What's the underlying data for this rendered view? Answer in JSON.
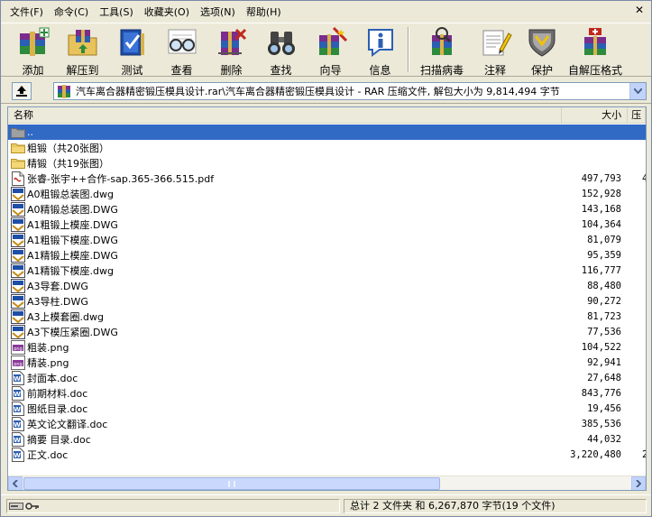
{
  "menu": [
    "文件(F)",
    "命令(C)",
    "工具(S)",
    "收藏夹(O)",
    "选项(N)",
    "帮助(H)"
  ],
  "toolbar": [
    {
      "label": "添加",
      "icon": "add-books-icon"
    },
    {
      "label": "解压到",
      "icon": "extract-folder-icon"
    },
    {
      "label": "测试",
      "icon": "test-book-icon"
    },
    {
      "label": "查看",
      "icon": "view-glasses-icon"
    },
    {
      "label": "删除",
      "icon": "delete-icon"
    },
    {
      "label": "查找",
      "icon": "find-binoculars-icon"
    },
    {
      "label": "向导",
      "icon": "wizard-icon"
    },
    {
      "label": "信息",
      "icon": "info-icon"
    },
    {
      "label": "扫描病毒",
      "icon": "virus-scan-icon"
    },
    {
      "label": "注释",
      "icon": "comment-icon"
    },
    {
      "label": "保护",
      "icon": "protect-shield-icon"
    },
    {
      "label": "自解压格式",
      "icon": "sfx-icon"
    }
  ],
  "address": {
    "text": "汽车离合器精密锻压模具设计.rar\\汽车离合器精密锻压模具设计 - RAR 压缩文件, 解包大小为 9,814,494 字节"
  },
  "columns": {
    "name": "名称",
    "size": "大小",
    "packed": "压"
  },
  "files": [
    {
      "name": "..",
      "size": "",
      "packed": "",
      "type": "parent",
      "selected": true
    },
    {
      "name": "粗锻（共20张图）",
      "size": "",
      "packed": "",
      "type": "folder"
    },
    {
      "name": "精锻（共19张图）",
      "size": "",
      "packed": "",
      "type": "folder"
    },
    {
      "name": "张睿-张宇++合作-sap.365-366.515.pdf",
      "size": "497,793",
      "packed": "4",
      "type": "pdf"
    },
    {
      "name": "A0粗锻总装图.dwg",
      "size": "152,928",
      "packed": "",
      "type": "dwg"
    },
    {
      "name": "A0精锻总装图.DWG",
      "size": "143,168",
      "packed": "",
      "type": "dwg"
    },
    {
      "name": "A1粗锻上模座.DWG",
      "size": "104,364",
      "packed": "",
      "type": "dwg"
    },
    {
      "name": "A1粗锻下模座.DWG",
      "size": "81,079",
      "packed": "",
      "type": "dwg"
    },
    {
      "name": "A1精锻上模座.DWG",
      "size": "95,359",
      "packed": "",
      "type": "dwg"
    },
    {
      "name": "A1精锻下模座.dwg",
      "size": "116,777",
      "packed": "",
      "type": "dwg"
    },
    {
      "name": "A3导套.DWG",
      "size": "88,480",
      "packed": "",
      "type": "dwg"
    },
    {
      "name": "A3导柱.DWG",
      "size": "90,272",
      "packed": "",
      "type": "dwg"
    },
    {
      "name": "A3上模套圈.dwg",
      "size": "81,723",
      "packed": "",
      "type": "dwg"
    },
    {
      "name": "A3下模压紧圈.DWG",
      "size": "77,536",
      "packed": "",
      "type": "dwg"
    },
    {
      "name": "粗装.png",
      "size": "104,522",
      "packed": "",
      "type": "png"
    },
    {
      "name": "精装.png",
      "size": "92,941",
      "packed": "",
      "type": "png"
    },
    {
      "name": "封面本.doc",
      "size": "27,648",
      "packed": "",
      "type": "doc"
    },
    {
      "name": "前期材料.doc",
      "size": "843,776",
      "packed": "",
      "type": "doc"
    },
    {
      "name": "图纸目录.doc",
      "size": "19,456",
      "packed": "",
      "type": "doc"
    },
    {
      "name": "英文论文翻译.doc",
      "size": "385,536",
      "packed": "",
      "type": "doc"
    },
    {
      "name": "摘要 目录.doc",
      "size": "44,032",
      "packed": "",
      "type": "doc"
    },
    {
      "name": "正文.doc",
      "size": "3,220,480",
      "packed": "2",
      "type": "doc"
    }
  ],
  "status": {
    "right": "总计 2 文件夹 和 6,267,870 字节(19 个文件)"
  },
  "colors": {
    "selection": "#316ac5",
    "chrome": "#ece9d8",
    "border": "#7f9db9"
  }
}
